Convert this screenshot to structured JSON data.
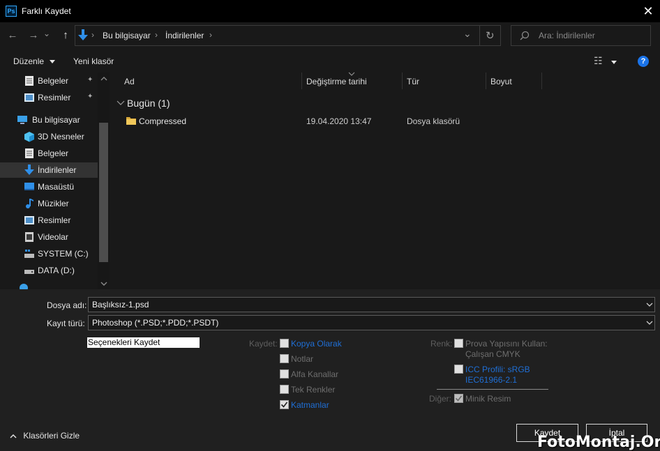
{
  "window": {
    "title": "Farklı Kaydet",
    "app_icon_text": "Ps",
    "close_glyph": "✕"
  },
  "nav": {
    "back_glyph": "←",
    "forward_glyph": "→",
    "recent_glyph": "⌄",
    "up_glyph": "↑",
    "breadcrumb": [
      "Bu bilgisayar",
      "İndirilenler"
    ],
    "sep_glyph": "›",
    "refresh_glyph": "↻",
    "dropdown_glyph": "⌄",
    "search_placeholder": "Ara: İndirilenler",
    "search_icon": "search-icon"
  },
  "toolbar": {
    "organize_label": "Düzenle",
    "new_folder_label": "Yeni klasör",
    "view_glyph": "☷",
    "help_glyph": "?"
  },
  "sidebar": {
    "items": [
      {
        "label": "Belgeler",
        "icon": "document-icon",
        "pinned": true
      },
      {
        "label": "Resimler",
        "icon": "pictures-icon",
        "pinned": true
      },
      {
        "label": "Bu bilgisayar",
        "icon": "computer-icon"
      },
      {
        "label": "3D Nesneler",
        "icon": "cube-icon"
      },
      {
        "label": "Belgeler",
        "icon": "document-icon"
      },
      {
        "label": "İndirilenler",
        "icon": "download-icon",
        "selected": true
      },
      {
        "label": "Masaüstü",
        "icon": "desktop-icon"
      },
      {
        "label": "Müzikler",
        "icon": "music-icon"
      },
      {
        "label": "Resimler",
        "icon": "pictures-icon"
      },
      {
        "label": "Videolar",
        "icon": "video-icon"
      },
      {
        "label": "SYSTEM (C:)",
        "icon": "drive-system-icon"
      },
      {
        "label": "DATA (D:)",
        "icon": "drive-icon"
      }
    ],
    "pin_glyph": "📌"
  },
  "filelist": {
    "columns": [
      "Ad",
      "Değiştirme tarihi",
      "Tür",
      "Boyut"
    ],
    "group_label": "Bugün (1)",
    "rows": [
      {
        "name": "Compressed",
        "modified": "19.04.2020 13:47",
        "type": "Dosya klasörü",
        "size": ""
      }
    ]
  },
  "save": {
    "filename_label": "Dosya adı:",
    "filename_value": "Başlıksız-1.psd",
    "filetype_label": "Kayıt türü:",
    "filetype_value": "Photoshop (*.PSD;*.PDD;*.PSDT)",
    "options_title": "Seçenekleri Kaydet",
    "save_group_label": "Kaydet:",
    "save_options": [
      {
        "label": "Kopya Olarak",
        "checked": false,
        "link": true
      },
      {
        "label": "Notlar",
        "checked": false,
        "link": false
      },
      {
        "label": "Alfa Kanallar",
        "checked": false,
        "link": false
      },
      {
        "label": "Tek Renkler",
        "checked": false,
        "link": false
      },
      {
        "label": "Katmanlar",
        "checked": true,
        "link": true
      }
    ],
    "color_group_label": "Renk:",
    "proof_label_1": "Prova Yapısını Kullan:",
    "proof_label_2": "Çalışan CMYK",
    "icc_label_1": "ICC Profili: sRGB",
    "icc_label_2": "IEC61966-2.1",
    "other_group_label": "Diğer:",
    "thumbnail_label": "Minik Resim",
    "hide_folders_label": "Klasörleri Gizle",
    "save_button": "Kaydet",
    "cancel_button": "İptal"
  },
  "watermark": "FotoMontaj.Org",
  "colors": {
    "accent": "#1f6fd6",
    "download_blue": "#2f8fe8",
    "folder_yellow": "#f1c85a",
    "help_blue": "#1a73e8"
  }
}
